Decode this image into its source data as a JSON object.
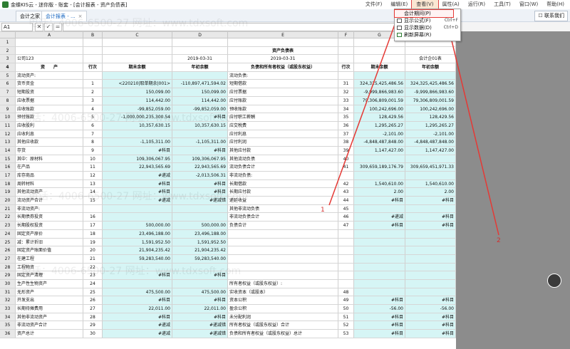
{
  "window": {
    "title": "金蝶KIS云 - 迷你版 - 账套 - [会计报表 - 资产负债表]",
    "menus": [
      "文件(F)",
      "编辑(E)",
      "查看(V)",
      "属性(A)",
      "运行(R)",
      "工具(T)",
      "窗口(W)",
      "帮助(H)"
    ],
    "active_menu": "查看(V)"
  },
  "tabs": [
    {
      "label": "会计之家"
    },
    {
      "label": "会计报表 - ..."
    }
  ],
  "contact_button": "联系我们",
  "formula_bar": {
    "cell_ref": "A1",
    "cancel": "✕",
    "confirm": "✓",
    "equals": "="
  },
  "view_menu": {
    "items": [
      {
        "label": "会计期间(P)",
        "shortcut": ""
      },
      {
        "label": "显示公式(F)",
        "shortcut": "Ctrl+F"
      },
      {
        "label": "显示数据(D)",
        "shortcut": "Ctrl+D"
      },
      {
        "label": "刷新屏幕(R)",
        "shortcut": ""
      }
    ]
  },
  "annotations": {
    "arrow1": "1",
    "arrow2": "2"
  },
  "watermark": "电话：4006-6500-27  网址：www.tdxsoft.com",
  "sheet": {
    "columns": [
      "",
      "A",
      "B",
      "C",
      "D",
      "E",
      "F",
      "G",
      "H"
    ],
    "rows": [
      {
        "n": "1",
        "a": "",
        "b": "",
        "c": "",
        "d": "",
        "e": "",
        "f": "",
        "g": "",
        "h": ""
      },
      {
        "n": "2",
        "a": "",
        "b": "",
        "c": "",
        "d": "",
        "e": "资产负债表",
        "f": "",
        "g": "",
        "h": ""
      },
      {
        "n": "3",
        "a": "公司123",
        "b": "",
        "c": "",
        "d": "2019-03-31",
        "e": "2019-03-31",
        "f": "",
        "g": "",
        "h": "会计企01表"
      },
      {
        "n": "4",
        "a": "资　　产",
        "b": "行次",
        "c": "期末余额",
        "d": "年初余额",
        "e": "负债和所有者权益（或股东权益）",
        "f": "行次",
        "g": "期末余额",
        "h": "年初余额"
      },
      {
        "n": "5",
        "a": "流动资产:",
        "b": "",
        "c": "",
        "d": "",
        "e": "流动负债:",
        "f": "",
        "g": "",
        "h": ""
      },
      {
        "n": "6",
        "a": "货币资金",
        "b": "1",
        "c": "<220210|取单期余|001>",
        "d": "-110,897,471,594.02",
        "e": "短期借款",
        "f": "31",
        "g": "324,325,425,486.56",
        "h": "324,325,425,486.56"
      },
      {
        "n": "7",
        "a": "短期投资",
        "b": "2",
        "c": "150,099.00",
        "d": "150,099.00",
        "e": "应付票据",
        "f": "32",
        "g": "-9,999,866,983.60",
        "h": "-9,999,866,983.60"
      },
      {
        "n": "8",
        "a": "应收票据",
        "b": "3",
        "c": "114,442.00",
        "d": "114,442.00",
        "e": "应付账款",
        "f": "33",
        "g": "79,306,809,001.59",
        "h": "79,306,809,001.59"
      },
      {
        "n": "9",
        "a": "应收账款",
        "b": "4",
        "c": "-99,852,059.00",
        "d": "-99,852,059.00",
        "e": "预收账款",
        "f": "34",
        "g": "100,242,696.00",
        "h": "100,242,696.00"
      },
      {
        "n": "10",
        "a": "预付账款",
        "b": "5",
        "c": "-1,000,000,235,300.54",
        "d": "#科目",
        "e": "应付职工薪酬",
        "f": "35",
        "g": "128,429.56",
        "h": "128,429.56"
      },
      {
        "n": "11",
        "a": "应收股利",
        "b": "6",
        "c": "10,357,630.15",
        "d": "10,357,630.15",
        "e": "应交税费",
        "f": "36",
        "g": "1,295,265.27",
        "h": "1,295,265.27"
      },
      {
        "n": "12",
        "a": "应收利息",
        "b": "7",
        "c": "",
        "d": "",
        "e": "应付利息",
        "f": "37",
        "g": "-2,101.00",
        "h": "-2,101.00"
      },
      {
        "n": "13",
        "a": "其他应收款",
        "b": "8",
        "c": "-1,105,311.00",
        "d": "-1,105,311.00",
        "e": "应付利润",
        "f": "38",
        "g": "-4,848,487,848.00",
        "h": "-4,848,487,848.00"
      },
      {
        "n": "14",
        "a": "存货",
        "b": "9",
        "c": "#科目",
        "d": "#科目",
        "e": "其他应付款",
        "f": "39",
        "g": "1,147,427.00",
        "h": "1,147,427.00"
      },
      {
        "n": "15",
        "a": "其中：原材料",
        "b": "10",
        "c": "109,306,067.95",
        "d": "109,306,067.95",
        "e": "其他流动负债",
        "f": "40",
        "g": "",
        "h": ""
      },
      {
        "n": "16",
        "a": "在产品",
        "b": "11",
        "c": "22,943,565.69",
        "d": "22,943,565.69",
        "e": "流动负债合计",
        "f": "41",
        "g": "309,659,189,176.79",
        "h": "309,659,451,971.33"
      },
      {
        "n": "17",
        "a": "库存商品",
        "b": "12",
        "c": "#递减",
        "d": "-2,013,506.31",
        "e": "非流动负债:",
        "f": "",
        "g": "",
        "h": ""
      },
      {
        "n": "18",
        "a": "周转材料",
        "b": "13",
        "c": "#科目",
        "d": "#科目",
        "e": "长期借款",
        "f": "42",
        "g": "1,540,610.00",
        "h": "1,540,610.00"
      },
      {
        "n": "19",
        "a": "其他流动资产",
        "b": "14",
        "c": "#科目",
        "d": "#科目",
        "e": "长期应付款",
        "f": "43",
        "g": "2.00",
        "h": "2.00"
      },
      {
        "n": "20",
        "a": "流动资产合计",
        "b": "15",
        "c": "#递减",
        "d": "#递减错",
        "e": "递延收益",
        "f": "44",
        "g": "#科目",
        "h": "#科目"
      },
      {
        "n": "21",
        "a": "非流动资产:",
        "b": "",
        "c": "",
        "d": "",
        "e": "其他非流动负债",
        "f": "45",
        "g": "",
        "h": ""
      },
      {
        "n": "22",
        "a": "长期债券投资",
        "b": "16",
        "c": "",
        "d": "",
        "e": "非流动负债合计",
        "f": "46",
        "g": "#递减",
        "h": "#科目"
      },
      {
        "n": "23",
        "a": "长期股权投资",
        "b": "17",
        "c": "500,000.00",
        "d": "500,000.00",
        "e": "负债合计",
        "f": "47",
        "g": "#科目",
        "h": "#科目"
      },
      {
        "n": "24",
        "a": "固定资产原价",
        "b": "18",
        "c": "23,496,188.00",
        "d": "23,496,188.00",
        "e": "",
        "f": "",
        "g": "",
        "h": ""
      },
      {
        "n": "25",
        "a": "减：累计折旧",
        "b": "19",
        "c": "1,591,952.50",
        "d": "1,591,952.50",
        "e": "",
        "f": "",
        "g": "",
        "h": ""
      },
      {
        "n": "26",
        "a": "固定资产账面价值",
        "b": "20",
        "c": "21,904,235.42",
        "d": "21,904,235.42",
        "e": "",
        "f": "",
        "g": "",
        "h": ""
      },
      {
        "n": "27",
        "a": "在建工程",
        "b": "21",
        "c": "59,283,540.00",
        "d": "59,283,540.00",
        "e": "",
        "f": "",
        "g": "",
        "h": ""
      },
      {
        "n": "28",
        "a": "工程物资",
        "b": "22",
        "c": "",
        "d": "",
        "e": "",
        "f": "",
        "g": "",
        "h": ""
      },
      {
        "n": "29",
        "a": "固定资产清理",
        "b": "23",
        "c": "#科目",
        "d": "#科目",
        "e": "",
        "f": "",
        "g": "",
        "h": ""
      },
      {
        "n": "30",
        "a": "生产性生物资产",
        "b": "24",
        "c": "",
        "d": "",
        "e": "所有者权益（或股东权益）:",
        "f": "",
        "g": "",
        "h": ""
      },
      {
        "n": "31",
        "a": "无形资产",
        "b": "25",
        "c": "475,500.00",
        "d": "475,500.00",
        "e": "实收资本（或股本）",
        "f": "48",
        "g": "",
        "h": ""
      },
      {
        "n": "32",
        "a": "开发支出",
        "b": "26",
        "c": "#科目",
        "d": "#科目",
        "e": "资本公积",
        "f": "49",
        "g": "#科目",
        "h": "#科目"
      },
      {
        "n": "33",
        "a": "长期待摊费用",
        "b": "27",
        "c": "22,011.00",
        "d": "22,011.00",
        "e": "盈余公积",
        "f": "50",
        "g": "-56.00",
        "h": "-56.00"
      },
      {
        "n": "34",
        "a": "其他非流动资产",
        "b": "28",
        "c": "#科目",
        "d": "#科目",
        "e": "未分配利润",
        "f": "51",
        "g": "#科目",
        "h": "#科目"
      },
      {
        "n": "35",
        "a": "非流动资产合计",
        "b": "29",
        "c": "#递减",
        "d": "#递减错",
        "e": "所有者权益（或股东权益）合计",
        "f": "52",
        "g": "#科目",
        "h": "#科目"
      },
      {
        "n": "36",
        "a": "资产总计",
        "b": "30",
        "c": "#递减",
        "d": "#递减错",
        "e": "负债和所有者权益（或股东权益）总计",
        "f": "53",
        "g": "#科目",
        "h": "#科目"
      }
    ]
  }
}
